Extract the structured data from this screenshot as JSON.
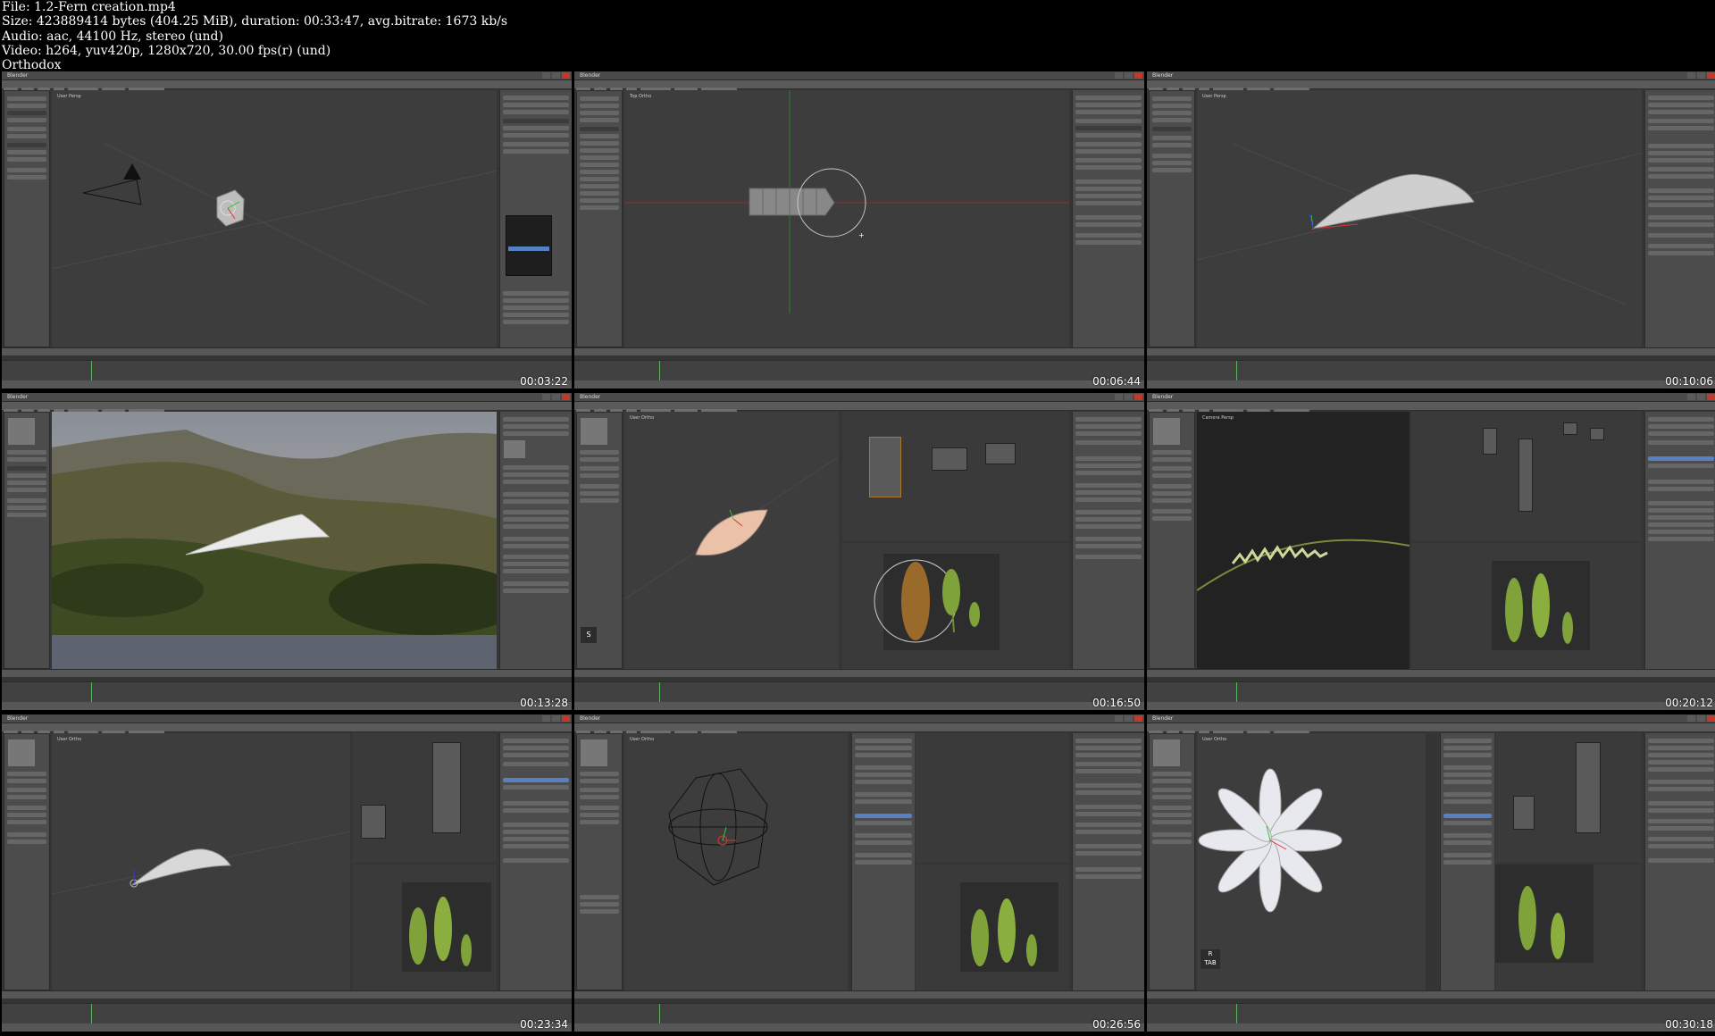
{
  "file_info": {
    "line1": "File: 1.2-Fern creation.mp4",
    "line2": "Size: 423889414 bytes (404.25 MiB), duration: 00:33:47, avg.bitrate: 1673 kb/s",
    "line3": "Audio: aac, 44100 Hz, stereo (und)",
    "line4": "Video: h264, yuv420p, 1280x720, 30.00 fps(r) (und)",
    "line5": "Orthodox"
  },
  "tiles": [
    {
      "timestamp": "00:03:22",
      "window_title": "Blender",
      "viewport_label": "User Persp"
    },
    {
      "timestamp": "00:06:44",
      "window_title": "Blender",
      "viewport_label": "Top Ortho"
    },
    {
      "timestamp": "00:10:06",
      "window_title": "Blender",
      "viewport_label": "User Persp"
    },
    {
      "timestamp": "00:13:28",
      "window_title": "Blender",
      "viewport_label": "Camera Persp"
    },
    {
      "timestamp": "00:16:50",
      "window_title": "Blender",
      "viewport_label": "User Ortho"
    },
    {
      "timestamp": "00:20:12",
      "window_title": "Blender",
      "viewport_label": "Camera Persp"
    },
    {
      "timestamp": "00:23:34",
      "window_title": "Blender",
      "viewport_label": "User Ortho"
    },
    {
      "timestamp": "00:26:56",
      "window_title": "Blender",
      "viewport_label": "User Ortho"
    },
    {
      "timestamp": "00:30:18",
      "window_title": "Blender",
      "viewport_label": "User Ortho"
    }
  ],
  "overlay_keys": {
    "tile5_key": "S",
    "tile9_key_r": "R",
    "tile9_key_tab": "TAB"
  },
  "colors": {
    "ui_bg": "#353535",
    "panel": "#4c4c4c",
    "viewport": "#3d3d3d",
    "accent_blue": "#5680c2",
    "close_red": "#c0392b"
  }
}
